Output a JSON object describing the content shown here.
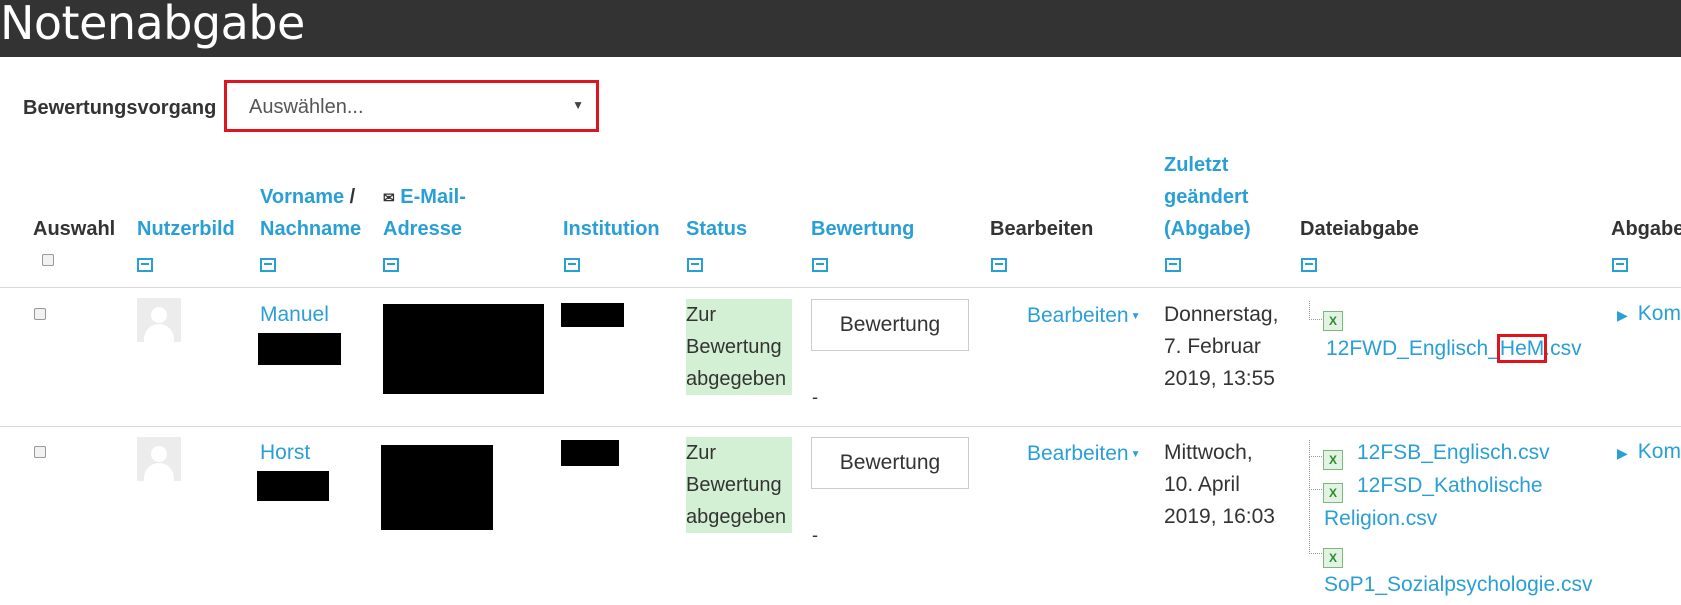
{
  "page_title": "Notenabgabe",
  "filter": {
    "label": "Bewertungsvorgang",
    "value": "Auswählen..."
  },
  "headers": {
    "auswahl": "Auswahl",
    "nutzerbild": "Nutzerbild",
    "vorname": "Vorname",
    "slash": "/",
    "nachname": "Nachname",
    "email": "E-Mail-",
    "email2": "Adresse",
    "institution": "Institution",
    "status": "Status",
    "bewertung": "Bewertung",
    "bearbeiten": "Bearbeiten",
    "zuletzt1": "Zuletzt",
    "zuletzt2": "geändert",
    "zuletzt3": "(Abgabe)",
    "dateiabgabe": "Dateiabgabe",
    "abgabe": "Abgabe"
  },
  "rows": [
    {
      "name": "Manuel",
      "status": [
        "Zur",
        "Bewertung",
        "abgegeben"
      ],
      "grade_button": "Bewertung",
      "grade_dash": "-",
      "edit": "Bearbeiten",
      "date": [
        "Donnerstag,",
        "7. Februar",
        "2019, 13:55"
      ],
      "files": [
        {
          "prefix": "12FWD_Englisch_",
          "highlight": "HeM",
          "suffix": ".csv"
        }
      ],
      "comment": "Kom"
    },
    {
      "name": "Horst",
      "status": [
        "Zur",
        "Bewertung",
        "abgegeben"
      ],
      "grade_button": "Bewertung",
      "grade_dash": "-",
      "edit": "Bearbeiten",
      "date": [
        "Mittwoch,",
        "10. April",
        "2019, 16:03"
      ],
      "files": [
        {
          "name": "12FSB_Englisch.csv"
        },
        {
          "name_line1": "12FSD_Katholische",
          "name_line2": "Religion.csv"
        },
        {
          "name": "SoP1_Sozialpsychologie.csv"
        }
      ],
      "comment": "Kom"
    }
  ],
  "colors": {
    "accent": "#2a9fd6",
    "header_bg": "#333333",
    "highlight_red": "#e0141e",
    "status_bg": "#d4f0d4"
  }
}
